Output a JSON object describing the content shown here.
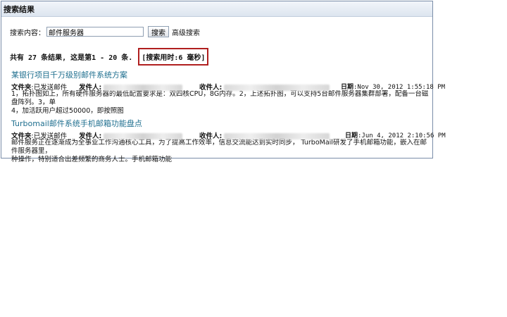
{
  "header": {
    "title": "搜索结果"
  },
  "search": {
    "label": "搜索内容：",
    "value": "邮件服务器",
    "button_label": "搜索",
    "advanced_label": "高级搜索"
  },
  "summary": {
    "text": "共有 27 条结果, 这是第1 - 20 条.",
    "time_text": "[搜索用时:6 毫秒]"
  },
  "results": [
    {
      "title": "某银行项目千万级别邮件系统方案",
      "folder_label": "文件夹",
      "folder_value": ":已发送邮件",
      "sender_label": "发件人",
      "receiver_label": "收件人",
      "date_label": "日期",
      "date_value": ":Nov 30, 2012 1:55:18 PM",
      "snippet": "1，拓扑图如上，所有硬件服务器的最低配置要求是：双四核CPU，8G内存。2，上述拓扑图，可以支持5台邮件服务器集群部署，配备一台磁盘阵列。3，单\n4，加活跃用户超过50000，即按照图"
    },
    {
      "title": "Turbomail邮件系统手机邮箱功能盘点",
      "folder_label": "文件夹",
      "folder_value": ":已发送邮件",
      "sender_label": "发件人",
      "receiver_label": "收件人",
      "date_label": "日期",
      "date_value": ":Jun 4, 2012 2:10:56 PM",
      "snippet": "邮件服务正在逐渐成为全事业工作沟通核心工具，为了提高工作效率，信息交流能达到实时同步， TurboMail研发了手机邮箱功能，嵌入在邮件服务器里，\n种操作，特别适合出差频繁的商务人士。手机邮箱功能"
    }
  ]
}
